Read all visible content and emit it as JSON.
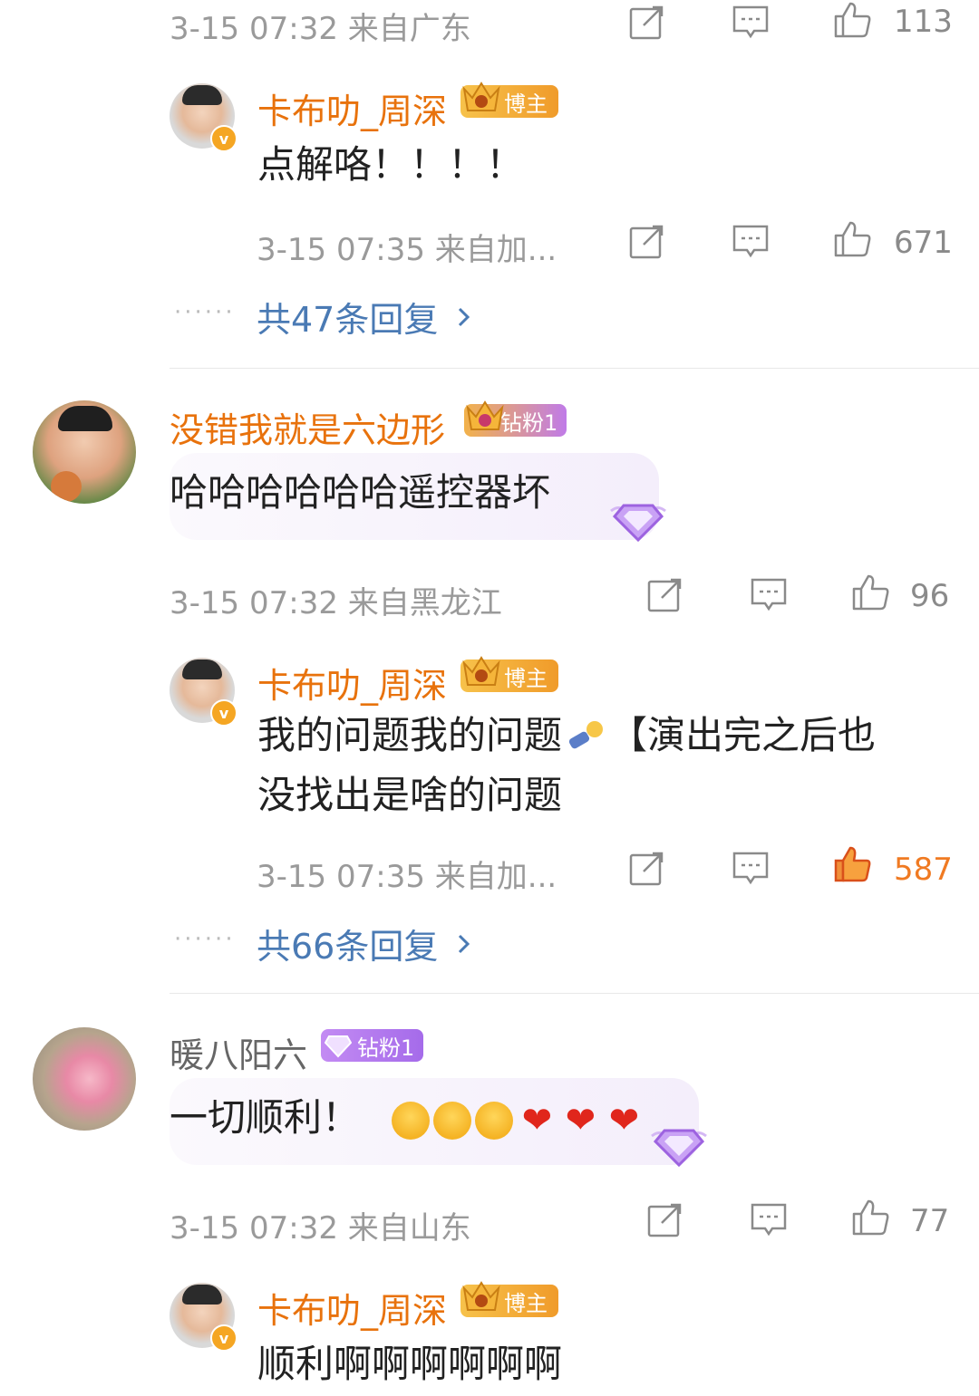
{
  "comments": [
    {
      "time": "3-15 07:32 来自广东",
      "likes": "113"
    },
    {
      "reply_user": "卡布叻_周深",
      "reply_badge": "博主",
      "reply_text": "点解咯！！！！",
      "reply_time": "3-15 07:35 来自加...",
      "reply_likes": "671",
      "replies_link": "共47条回复"
    },
    {
      "user": "没错我就是六边形",
      "badge": "钻粉1",
      "text": "哈哈哈哈哈哈遥控器坏",
      "time": "3-15 07:32 来自黑龙江",
      "likes": "96",
      "reply_user": "卡布叻_周深",
      "reply_badge": "博主",
      "reply_text_line1": "我的问题我的问题",
      "reply_text_line1b": "【演出完之后也",
      "reply_text_line2": "没找出是啥的问题",
      "reply_time": "3-15 07:35 来自加...",
      "reply_likes": "587",
      "replies_link": "共66条回复"
    },
    {
      "user": "暖八阳六",
      "badge": "钻粉1",
      "text": "一切顺利！",
      "time": "3-15 07:32 来自山东",
      "likes": "77",
      "reply_user": "卡布叻_周深",
      "reply_badge": "博主",
      "reply_text": "顺利啊啊啊啊啊啊"
    }
  ],
  "verified_mark": "v",
  "more_dots": "······",
  "colors": {
    "name_orange": "#e8720c",
    "link_blue": "#4a7ab4",
    "like_active": "#f07a22"
  },
  "icons": [
    "share-icon",
    "comment-icon",
    "like-icon",
    "chevron-right-icon",
    "crown-icon",
    "diamond-icon"
  ]
}
